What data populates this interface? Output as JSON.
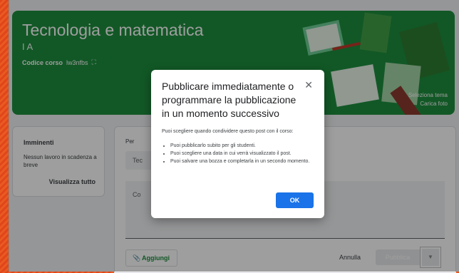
{
  "banner": {
    "title": "Tecnologia e matematica",
    "section": "I A",
    "code_label": "Codice corso",
    "code_value": "lw3nfbs",
    "fullscreen_icon": "fullscreen-icon",
    "select_theme": "Seleziona tema",
    "upload_photo": "Carica foto"
  },
  "upcoming": {
    "heading": "Imminenti",
    "text": "Nessun lavoro in scadenza a breve",
    "view_all": "Visualizza tutto"
  },
  "composer": {
    "for_label": "Per",
    "class_chip": "Tec",
    "compose_placeholder": "Co",
    "add_button": "Aggiungi",
    "add_icon": "paperclip-icon",
    "cancel_button": "Annulla",
    "publish_button": "Pubblica",
    "dropdown_icon": "caret-down-icon"
  },
  "dialog": {
    "title": "Pubblicare immediatamente o programmare la pubblicazione in un momento successivo",
    "intro": "Puoi scegliere quando condividere questo post con il corso:",
    "items": [
      "Puoi pubblicarlo subito per gli studenti.",
      "Puoi scegliere una data in cui verrà visualizzato il post.",
      "Puoi salvare una bozza e completarla in un secondo momento."
    ],
    "ok_button": "OK",
    "close_icon": "close-icon"
  },
  "colors": {
    "banner_green": "#1e8e3e",
    "primary_blue": "#1a73e8",
    "background_orange": "#e0461a"
  }
}
